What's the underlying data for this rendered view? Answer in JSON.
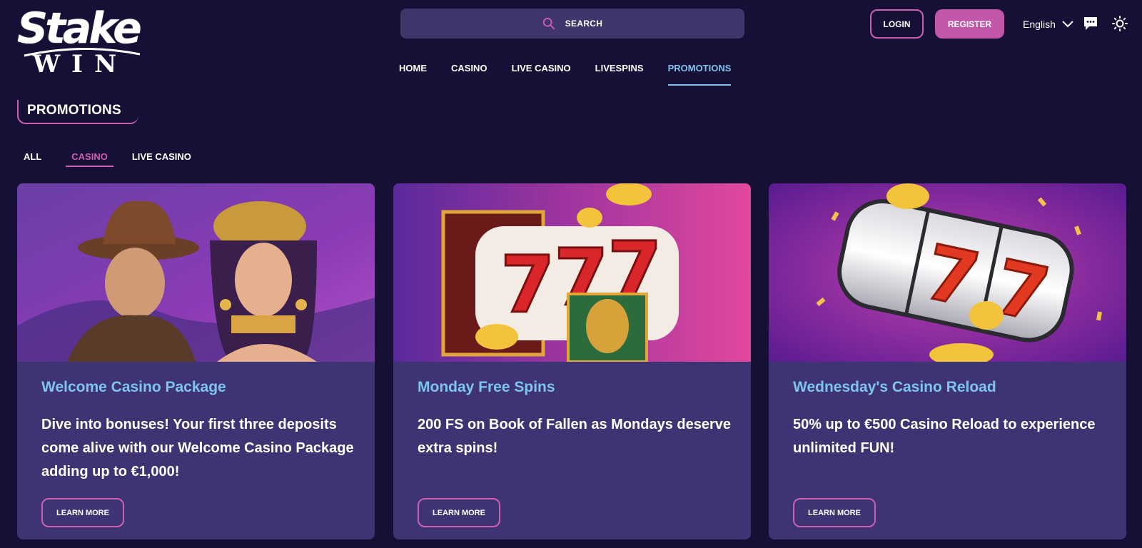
{
  "brand": {
    "logo_top": "Stake",
    "logo_bottom": "WIN"
  },
  "header": {
    "search_label": "SEARCH",
    "login_label": "LOGIN",
    "register_label": "REGISTER",
    "language": "English",
    "icons": {
      "search": "search-icon",
      "language": "chevron-down-icon",
      "chat": "chat-icon",
      "theme": "sun-icon"
    }
  },
  "nav": {
    "items": [
      {
        "label": "HOME"
      },
      {
        "label": "CASINO"
      },
      {
        "label": "LIVE CASINO"
      },
      {
        "label": "LIVESPINS"
      },
      {
        "label": "PROMOTIONS",
        "active": true
      }
    ]
  },
  "page": {
    "title": "PROMOTIONS"
  },
  "filters": {
    "tabs": [
      {
        "label": "ALL"
      },
      {
        "label": "CASINO",
        "active": true
      },
      {
        "label": "LIVE CASINO"
      }
    ]
  },
  "promotions": [
    {
      "title": "Welcome Casino Package",
      "description": "Dive into bonuses! Your first three deposits come alive with our Welcome Casino Package adding up to €1,000!",
      "cta": "LEARN MORE"
    },
    {
      "title": "Monday Free Spins",
      "description": "200 FS on Book of Fallen as Mondays deserve extra spins!",
      "cta": "LEARN MORE"
    },
    {
      "title": "Wednesday's Casino Reload",
      "description": "50% up to €500 Casino Reload to experience unlimited FUN!",
      "cta": "LEARN MORE"
    }
  ],
  "colors": {
    "background": "#160f36",
    "card": "#3e3473",
    "accent_pink": "#cf5fb1",
    "accent_blue": "#7fc4ee",
    "search_bg": "#40366c"
  }
}
